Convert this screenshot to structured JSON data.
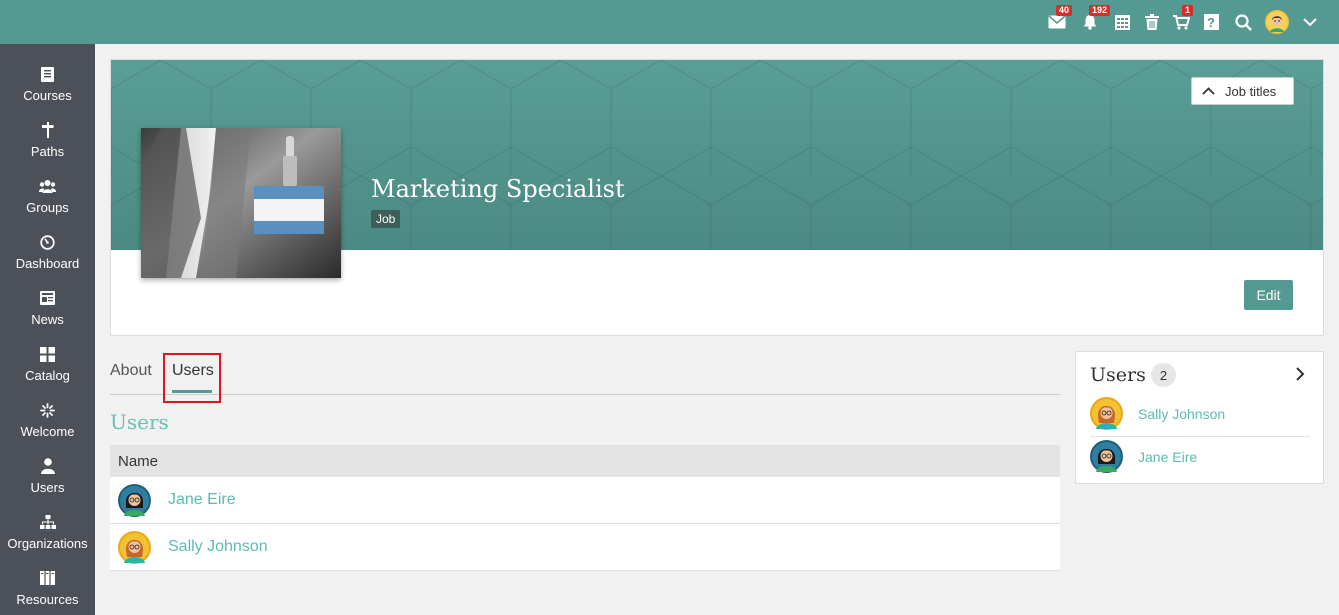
{
  "topbar": {
    "messages_badge": "40",
    "notifications_badge": "192",
    "cart_badge": "1",
    "help_label": "?"
  },
  "sidebar": {
    "items": [
      {
        "label": "Courses",
        "icon": "courses-icon"
      },
      {
        "label": "Paths",
        "icon": "paths-icon"
      },
      {
        "label": "Groups",
        "icon": "groups-icon"
      },
      {
        "label": "Dashboard",
        "icon": "dashboard-icon"
      },
      {
        "label": "News",
        "icon": "news-icon"
      },
      {
        "label": "Catalog",
        "icon": "catalog-icon"
      },
      {
        "label": "Welcome",
        "icon": "welcome-icon"
      },
      {
        "label": "Users",
        "icon": "users-icon"
      },
      {
        "label": "Organizations",
        "icon": "organizations-icon"
      },
      {
        "label": "Resources",
        "icon": "resources-icon"
      }
    ]
  },
  "header": {
    "job_titles_button": "Job titles",
    "title": "Marketing Specialist",
    "tag": "Job",
    "edit_button": "Edit"
  },
  "tabs": [
    {
      "label": "About"
    },
    {
      "label": "Users",
      "active": true
    }
  ],
  "main": {
    "section_title": "Users",
    "table": {
      "column_header": "Name",
      "rows": [
        {
          "name": "Jane Eire",
          "avatar": "dark-hair-female-avatar"
        },
        {
          "name": "Sally Johnson",
          "avatar": "red-hair-female-avatar"
        }
      ]
    }
  },
  "right_panel": {
    "title": "Users",
    "count": "2",
    "users": [
      {
        "name": "Sally Johnson",
        "avatar": "red-hair-female-avatar"
      },
      {
        "name": "Jane Eire",
        "avatar": "dark-hair-female-avatar"
      }
    ]
  },
  "colors": {
    "accent": "#559a92",
    "link": "#5bbbb2",
    "sidebar": "#4c5159",
    "badge": "#d0312d",
    "highlight": "#e0141c"
  }
}
